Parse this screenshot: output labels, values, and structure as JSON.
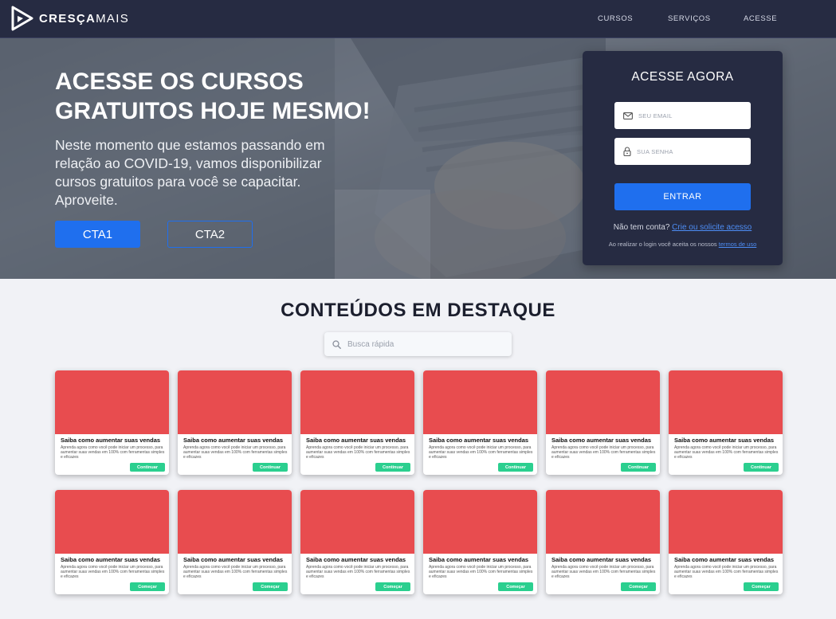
{
  "brand": {
    "name_bold": "CRESÇA",
    "name_light": "MAIS"
  },
  "nav": {
    "items": [
      {
        "label": "CURSOS"
      },
      {
        "label": "SERVIÇOS"
      },
      {
        "label": "ACESSE"
      }
    ]
  },
  "hero": {
    "title": "ACESSE OS CURSOS GRATUITOS HOJE MESMO!",
    "text": "Neste momento que estamos passando em relação ao COVID-19, vamos disponibilizar cursos gratuitos para você se capacitar. Aproveite.",
    "cta1": "CTA1",
    "cta2": "CTA2"
  },
  "login": {
    "title": "ACESSE AGORA",
    "email_placeholder": "SEU EMAIL",
    "password_placeholder": "SUA SENHA",
    "submit": "ENTRAR",
    "no_account": "Não tem conta?",
    "signup_link": "Crie ou solicite acesso",
    "terms_prefix": "Ao realizar o login você aceita os nossos",
    "terms_link": "termos de uso"
  },
  "featured": {
    "title": "CONTEÚDOS EM DESTAQUE",
    "search_placeholder": "Busca rápida",
    "row1": [
      {
        "title": "Saiba como aumentar suas vendas",
        "desc": "Aprenda agora como você pode iniciar um processo, para aumentar suas vendas em 100% com ferramentas simples e eficazes",
        "button": "Continuar"
      },
      {
        "title": "Saiba como aumentar suas vendas",
        "desc": "Aprenda agora como você pode iniciar um processo, para aumentar suas vendas em 100% com ferramentas simples e eficazes",
        "button": "Continuar"
      },
      {
        "title": "Saiba como aumentar suas vendas",
        "desc": "Aprenda agora como você pode iniciar um processo, para aumentar suas vendas em 100% com ferramentas simples e eficazes",
        "button": "Continuar"
      },
      {
        "title": "Saiba como aumentar suas vendas",
        "desc": "Aprenda agora como você pode iniciar um processo, para aumentar suas vendas em 100% com ferramentas simples e eficazes",
        "button": "Continuar"
      },
      {
        "title": "Saiba como aumentar suas vendas",
        "desc": "Aprenda agora como você pode iniciar um processo, para aumentar suas vendas em 100% com ferramentas simples e eficazes",
        "button": "Continuar"
      },
      {
        "title": "Saiba como aumentar suas vendas",
        "desc": "Aprenda agora como você pode iniciar um processo, para aumentar suas vendas em 100% com ferramentas simples e eficazes",
        "button": "Continuar"
      }
    ],
    "row2": [
      {
        "title": "Saiba como aumentar suas vendas",
        "desc": "Aprenda agora como você pode iniciar um processo, para aumentar suas vendas em 100% com ferramentas simples e eficazes",
        "button": "Começar"
      },
      {
        "title": "Saiba como aumentar suas vendas",
        "desc": "Aprenda agora como você pode iniciar um processo, para aumentar suas vendas em 100% com ferramentas simples e eficazes",
        "button": "Começar"
      },
      {
        "title": "Saiba como aumentar suas vendas",
        "desc": "Aprenda agora como você pode iniciar um processo, para aumentar suas vendas em 100% com ferramentas simples e eficazes",
        "button": "Começar"
      },
      {
        "title": "Saiba como aumentar suas vendas",
        "desc": "Aprenda agora como você pode iniciar um processo, para aumentar suas vendas em 100% com ferramentas simples e eficazes",
        "button": "Começar"
      },
      {
        "title": "Saiba como aumentar suas vendas",
        "desc": "Aprenda agora como você pode iniciar um processo, para aumentar suas vendas em 100% com ferramentas simples e eficazes",
        "button": "Começar"
      },
      {
        "title": "Saiba como aumentar suas vendas",
        "desc": "Aprenda agora como você pode iniciar um processo, para aumentar suas vendas em 100% com ferramentas simples e eficazes",
        "button": "Começar"
      }
    ]
  },
  "colors": {
    "nav_bg": "#262b42",
    "primary": "#1f6fee",
    "card_image": "#e84c4f",
    "card_button": "#2bcf8f",
    "page_bg": "#f1f2f6"
  }
}
